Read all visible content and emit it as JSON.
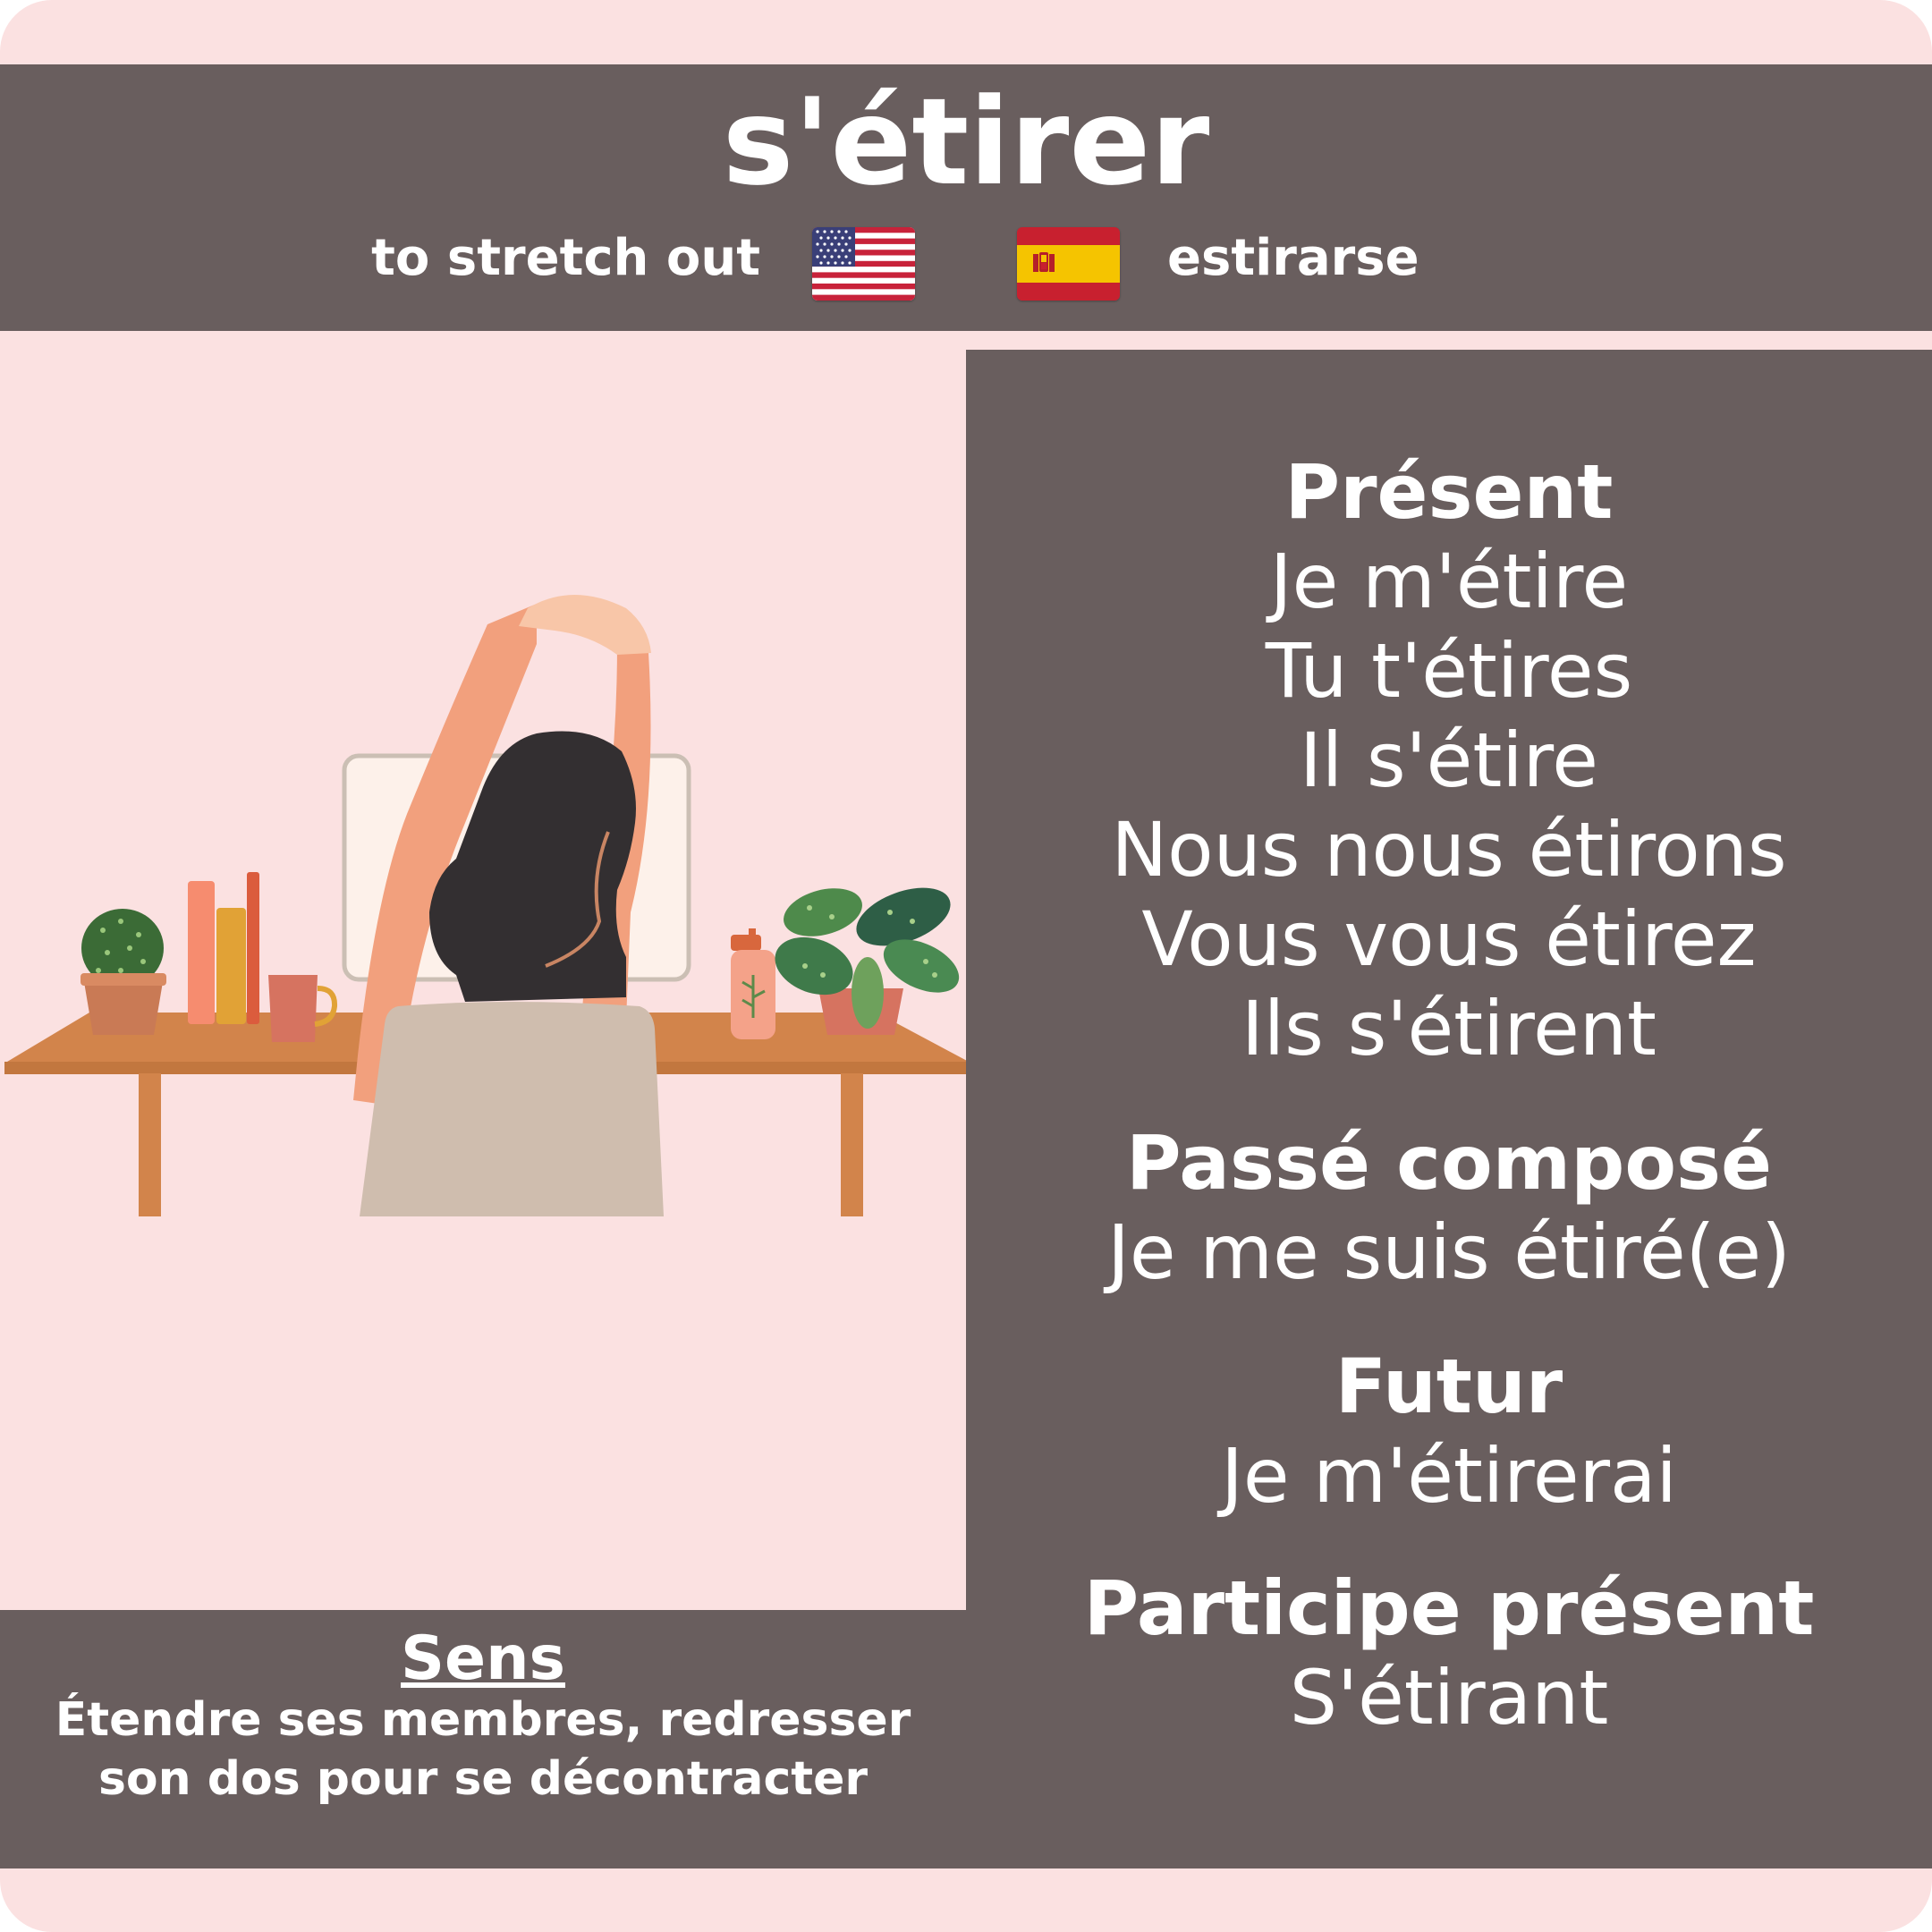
{
  "verb": "s'étirer",
  "translation_en": "to stretch out",
  "translation_es": "estirarse",
  "flags": {
    "en": "us-flag-icon",
    "es": "spain-flag-icon"
  },
  "conjugation": {
    "present": {
      "label": "Présent",
      "forms": [
        "Je m'étire",
        "Tu t'étires",
        "Il s'étire",
        "Nous nous étirons",
        "Vous vous étirez",
        "Ils s'étirent"
      ]
    },
    "passe_compose": {
      "label": "Passé composé",
      "form": "Je me suis étiré(e)"
    },
    "futur": {
      "label": "Futur",
      "form": "Je m'étirerai"
    },
    "participe_present": {
      "label": "Participe présent",
      "form": "S'étirant"
    }
  },
  "sens": {
    "title": "Sens",
    "line1": "Étendre ses membres, redresser",
    "line2": "son dos pour se décontracter"
  },
  "colors": {
    "background": "#fbe1e1",
    "panel": "#695e5e",
    "text": "#ffffff"
  }
}
